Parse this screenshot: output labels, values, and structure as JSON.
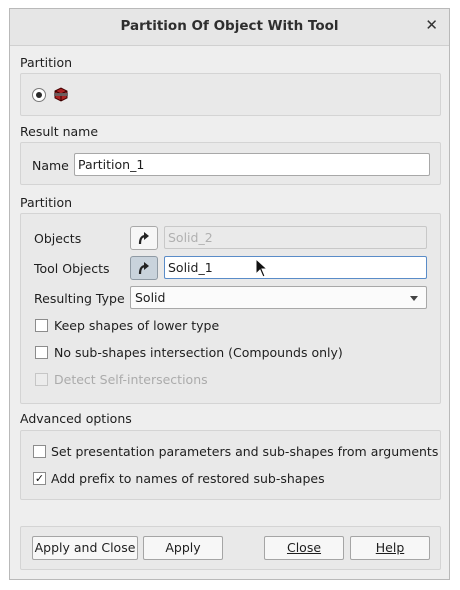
{
  "window": {
    "title": "Partition Of Object With Tool",
    "close_glyph": "✕"
  },
  "partition_group": {
    "label": "Partition"
  },
  "result_name": {
    "label": "Result name",
    "name_label": "Name",
    "name_value": "Partition_1"
  },
  "arguments": {
    "label": "Partition",
    "objects_label": "Objects",
    "objects_value": "Solid_2",
    "tool_objects_label": "Tool Objects",
    "tool_objects_value": "Solid_1",
    "resulting_type_label": "Resulting Type",
    "resulting_type_value": "Solid",
    "keep_shapes_label": "Keep shapes of lower type",
    "no_sub_shapes_label": "No sub-shapes intersection (Compounds only)",
    "detect_self_label": "Detect Self-intersections"
  },
  "advanced": {
    "label": "Advanced options",
    "set_presentation_label": "Set presentation parameters and sub-shapes from arguments",
    "add_prefix_label": "Add prefix to names of restored sub-shapes",
    "check_mark": "✓"
  },
  "buttons": {
    "apply_close": "Apply and Close",
    "apply": "Apply",
    "close": "Close",
    "help": "Help"
  }
}
